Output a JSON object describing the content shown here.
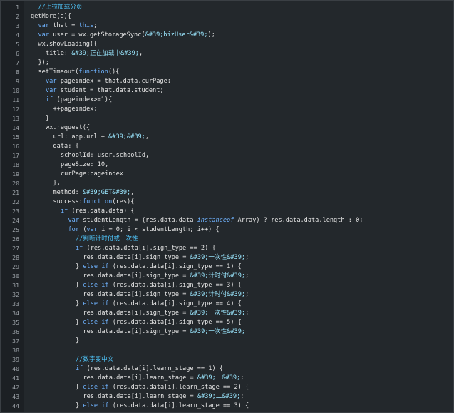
{
  "code_lines": [
    {
      "n": "1",
      "indent": 1,
      "tokens": [
        {
          "t": "//上拉加载分页",
          "c": "cmt"
        }
      ]
    },
    {
      "n": "2",
      "indent": 0,
      "tokens": [
        {
          "t": "getMore(e){",
          "c": ""
        }
      ]
    },
    {
      "n": "3",
      "indent": 1,
      "tokens": [
        {
          "t": "var",
          "c": "kw"
        },
        {
          "t": " that = ",
          "c": ""
        },
        {
          "t": "this",
          "c": "kw"
        },
        {
          "t": ";",
          "c": ""
        }
      ]
    },
    {
      "n": "4",
      "indent": 1,
      "tokens": [
        {
          "t": "var",
          "c": "kw"
        },
        {
          "t": " user = wx.getStorageSync(",
          "c": ""
        },
        {
          "t": "&#39;bizUser&#39;",
          "c": "cn"
        },
        {
          "t": ");",
          "c": ""
        }
      ]
    },
    {
      "n": "5",
      "indent": 1,
      "tokens": [
        {
          "t": "wx.showLoading({",
          "c": ""
        }
      ]
    },
    {
      "n": "6",
      "indent": 2,
      "tokens": [
        {
          "t": "title: ",
          "c": ""
        },
        {
          "t": "&#39;正在加载中&#39;",
          "c": "cn"
        },
        {
          "t": ",",
          "c": ""
        }
      ]
    },
    {
      "n": "7",
      "indent": 1,
      "tokens": [
        {
          "t": "});",
          "c": ""
        }
      ]
    },
    {
      "n": "8",
      "indent": 1,
      "tokens": [
        {
          "t": "setTimeout(",
          "c": ""
        },
        {
          "t": "function",
          "c": "kw"
        },
        {
          "t": "(){",
          "c": ""
        }
      ]
    },
    {
      "n": "9",
      "indent": 2,
      "tokens": [
        {
          "t": "var",
          "c": "kw"
        },
        {
          "t": " pageindex = that.data.curPage;",
          "c": ""
        }
      ]
    },
    {
      "n": "10",
      "indent": 2,
      "tokens": [
        {
          "t": "var",
          "c": "kw"
        },
        {
          "t": " student = that.data.student;",
          "c": ""
        }
      ]
    },
    {
      "n": "11",
      "indent": 2,
      "tokens": [
        {
          "t": "if",
          "c": "kw"
        },
        {
          "t": " (pageindex>=1){",
          "c": ""
        }
      ]
    },
    {
      "n": "12",
      "indent": 3,
      "tokens": [
        {
          "t": "++pageindex;",
          "c": ""
        }
      ]
    },
    {
      "n": "13",
      "indent": 2,
      "tokens": [
        {
          "t": "}",
          "c": ""
        }
      ]
    },
    {
      "n": "14",
      "indent": 2,
      "tokens": [
        {
          "t": "wx.request({",
          "c": ""
        }
      ]
    },
    {
      "n": "15",
      "indent": 3,
      "tokens": [
        {
          "t": "url: app.url + ",
          "c": ""
        },
        {
          "t": "&#39;&#39;",
          "c": "cn"
        },
        {
          "t": ",",
          "c": ""
        }
      ]
    },
    {
      "n": "16",
      "indent": 3,
      "tokens": [
        {
          "t": "data: {",
          "c": ""
        }
      ]
    },
    {
      "n": "17",
      "indent": 4,
      "tokens": [
        {
          "t": "schoolId: user.schoolId,",
          "c": ""
        }
      ]
    },
    {
      "n": "18",
      "indent": 4,
      "tokens": [
        {
          "t": "pageSize: 10,",
          "c": ""
        }
      ]
    },
    {
      "n": "19",
      "indent": 4,
      "tokens": [
        {
          "t": "curPage:pageindex",
          "c": ""
        }
      ]
    },
    {
      "n": "20",
      "indent": 3,
      "tokens": [
        {
          "t": "},",
          "c": ""
        }
      ]
    },
    {
      "n": "21",
      "indent": 3,
      "tokens": [
        {
          "t": "method: ",
          "c": ""
        },
        {
          "t": "&#39;GET&#39;",
          "c": "cn"
        },
        {
          "t": ",",
          "c": ""
        }
      ]
    },
    {
      "n": "22",
      "indent": 3,
      "tokens": [
        {
          "t": "success:",
          "c": ""
        },
        {
          "t": "function",
          "c": "kw"
        },
        {
          "t": "(res){",
          "c": ""
        }
      ]
    },
    {
      "n": "23",
      "indent": 4,
      "tokens": [
        {
          "t": "if",
          "c": "kw"
        },
        {
          "t": " (res.data.data) {",
          "c": ""
        }
      ]
    },
    {
      "n": "24",
      "indent": 5,
      "tokens": [
        {
          "t": "var",
          "c": "kw"
        },
        {
          "t": " studentLength = (res.data.data ",
          "c": ""
        },
        {
          "t": "instanceof",
          "c": "kwi"
        },
        {
          "t": " Array) ? res.data.data.length : 0;",
          "c": ""
        }
      ]
    },
    {
      "n": "25",
      "indent": 5,
      "tokens": [
        {
          "t": "for",
          "c": "kw"
        },
        {
          "t": " (",
          "c": ""
        },
        {
          "t": "var",
          "c": "kw"
        },
        {
          "t": " i = 0; i < studentLength; i++) {",
          "c": ""
        }
      ]
    },
    {
      "n": "26",
      "indent": 6,
      "tokens": [
        {
          "t": "//判断计时付或一次性",
          "c": "cmt"
        }
      ]
    },
    {
      "n": "27",
      "indent": 6,
      "tokens": [
        {
          "t": "if",
          "c": "kw"
        },
        {
          "t": " (res.data.data[i].sign_type == 2) {",
          "c": ""
        }
      ]
    },
    {
      "n": "28",
      "indent": 7,
      "tokens": [
        {
          "t": "res.data.data[i].sign_type = ",
          "c": ""
        },
        {
          "t": "&#39;一次性&#39;",
          "c": "cn"
        },
        {
          "t": ";",
          "c": ""
        }
      ]
    },
    {
      "n": "29",
      "indent": 6,
      "tokens": [
        {
          "t": "} ",
          "c": ""
        },
        {
          "t": "else if",
          "c": "kw"
        },
        {
          "t": " (res.data.data[i].sign_type == 1) {",
          "c": ""
        }
      ]
    },
    {
      "n": "30",
      "indent": 7,
      "tokens": [
        {
          "t": "res.data.data[i].sign_type = ",
          "c": ""
        },
        {
          "t": "&#39;计时付&#39;",
          "c": "cn"
        },
        {
          "t": ";",
          "c": ""
        }
      ]
    },
    {
      "n": "31",
      "indent": 6,
      "tokens": [
        {
          "t": "} ",
          "c": ""
        },
        {
          "t": "else if",
          "c": "kw"
        },
        {
          "t": " (res.data.data[i].sign_type == 3) {",
          "c": ""
        }
      ]
    },
    {
      "n": "32",
      "indent": 7,
      "tokens": [
        {
          "t": "res.data.data[i].sign_type = ",
          "c": ""
        },
        {
          "t": "&#39;计时付&#39;",
          "c": "cn"
        },
        {
          "t": ";",
          "c": ""
        }
      ]
    },
    {
      "n": "33",
      "indent": 6,
      "tokens": [
        {
          "t": "} ",
          "c": ""
        },
        {
          "t": "else if",
          "c": "kw"
        },
        {
          "t": " (res.data.data[i].sign_type == 4) {",
          "c": ""
        }
      ]
    },
    {
      "n": "34",
      "indent": 7,
      "tokens": [
        {
          "t": "res.data.data[i].sign_type = ",
          "c": ""
        },
        {
          "t": "&#39;一次性&#39;",
          "c": "cn"
        },
        {
          "t": ";",
          "c": ""
        }
      ]
    },
    {
      "n": "35",
      "indent": 6,
      "tokens": [
        {
          "t": "} ",
          "c": ""
        },
        {
          "t": "else if",
          "c": "kw"
        },
        {
          "t": " (res.data.data[i].sign_type == 5) {",
          "c": ""
        }
      ]
    },
    {
      "n": "36",
      "indent": 7,
      "tokens": [
        {
          "t": "res.data.data[i].sign_type = ",
          "c": ""
        },
        {
          "t": "&#39;一次性&#39;",
          "c": "cn"
        }
      ]
    },
    {
      "n": "37",
      "indent": 6,
      "tokens": [
        {
          "t": "}",
          "c": ""
        }
      ]
    },
    {
      "n": "38",
      "indent": 0,
      "tokens": []
    },
    {
      "n": "39",
      "indent": 6,
      "tokens": [
        {
          "t": "//数字变中文",
          "c": "cmt"
        }
      ]
    },
    {
      "n": "40",
      "indent": 6,
      "tokens": [
        {
          "t": "if",
          "c": "kw"
        },
        {
          "t": " (res.data.data[i].learn_stage == 1) {",
          "c": ""
        }
      ]
    },
    {
      "n": "41",
      "indent": 7,
      "tokens": [
        {
          "t": "res.data.data[i].learn_stage = ",
          "c": ""
        },
        {
          "t": "&#39;一&#39;",
          "c": "cn"
        },
        {
          "t": ";",
          "c": ""
        }
      ]
    },
    {
      "n": "42",
      "indent": 6,
      "tokens": [
        {
          "t": "} ",
          "c": ""
        },
        {
          "t": "else if",
          "c": "kw"
        },
        {
          "t": " (res.data.data[i].learn_stage == 2) {",
          "c": ""
        }
      ]
    },
    {
      "n": "43",
      "indent": 7,
      "tokens": [
        {
          "t": "res.data.data[i].learn_stage = ",
          "c": ""
        },
        {
          "t": "&#39;二&#39;",
          "c": "cn"
        },
        {
          "t": ";",
          "c": ""
        }
      ]
    },
    {
      "n": "44",
      "indent": 6,
      "tokens": [
        {
          "t": "} ",
          "c": ""
        },
        {
          "t": "else if",
          "c": "kw"
        },
        {
          "t": " (res.data.data[i].learn_stage == 3) {",
          "c": ""
        }
      ]
    }
  ],
  "colors": {
    "background": "#23282c",
    "gutter": "#1c2024",
    "keyword": "#6fb3ff",
    "comment": "#4fc3f7",
    "chinese_string": "#9be7ff",
    "default_text": "#e6e6e6",
    "line_number": "#9aa0a6"
  }
}
